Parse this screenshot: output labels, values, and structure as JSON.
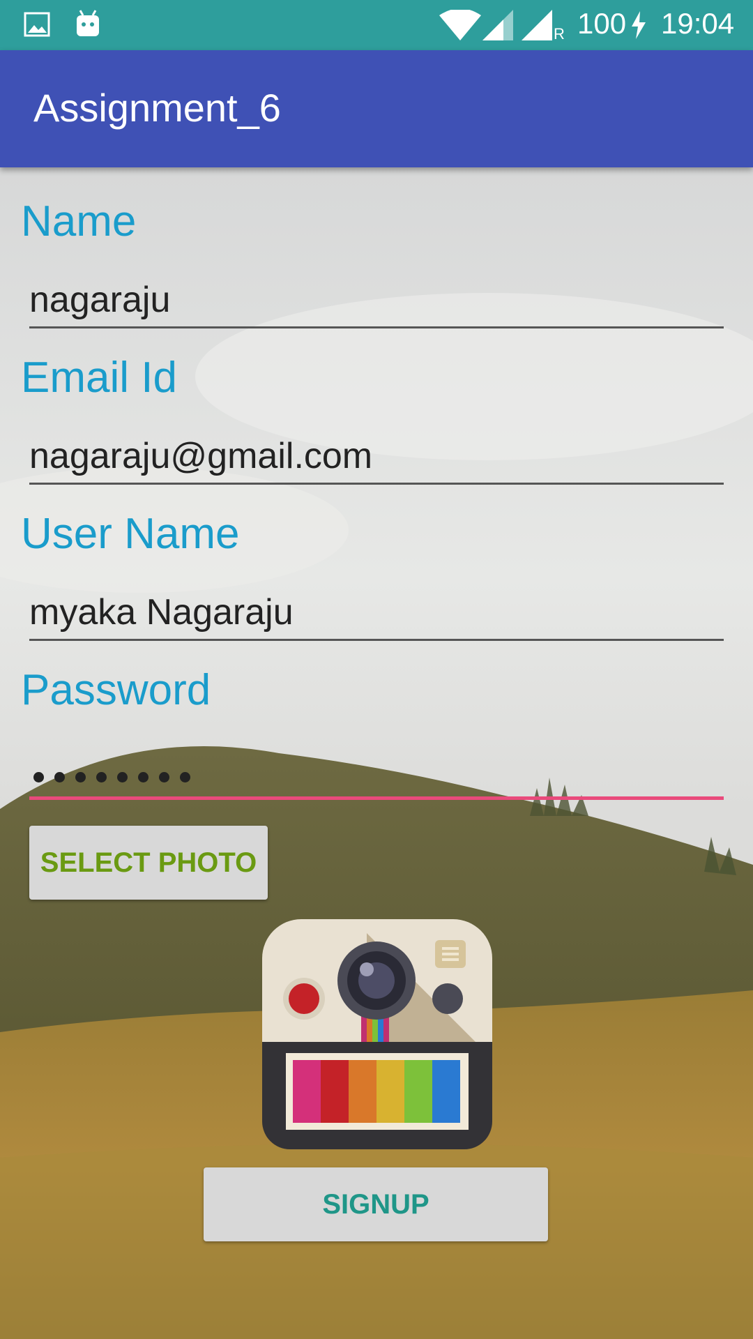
{
  "status_bar": {
    "battery": "100",
    "time": "19:04",
    "network_indicator": "R",
    "icons": [
      "image-icon",
      "android-icon",
      "wifi-icon",
      "signal-icon",
      "signal-roaming-icon",
      "charging-icon"
    ]
  },
  "app_bar": {
    "title": "Assignment_6"
  },
  "form": {
    "name": {
      "label": "Name",
      "value": "nagaraju"
    },
    "email": {
      "label": "Email Id",
      "value": "nagaraju@gmail.com"
    },
    "username": {
      "label": "User Name",
      "value": "myaka Nagaraju"
    },
    "password": {
      "label": "Password",
      "masked_length": 8
    }
  },
  "buttons": {
    "select_photo": "SELECT PHOTO",
    "signup": "SIGNUP"
  },
  "colors": {
    "status_bar": "#2e9e9c",
    "app_bar": "#3f51b5",
    "label": "#1a9ccb",
    "focus_underline": "#e94a7b",
    "select_photo_text": "#6a9a12",
    "signup_text": "#1f9688"
  }
}
